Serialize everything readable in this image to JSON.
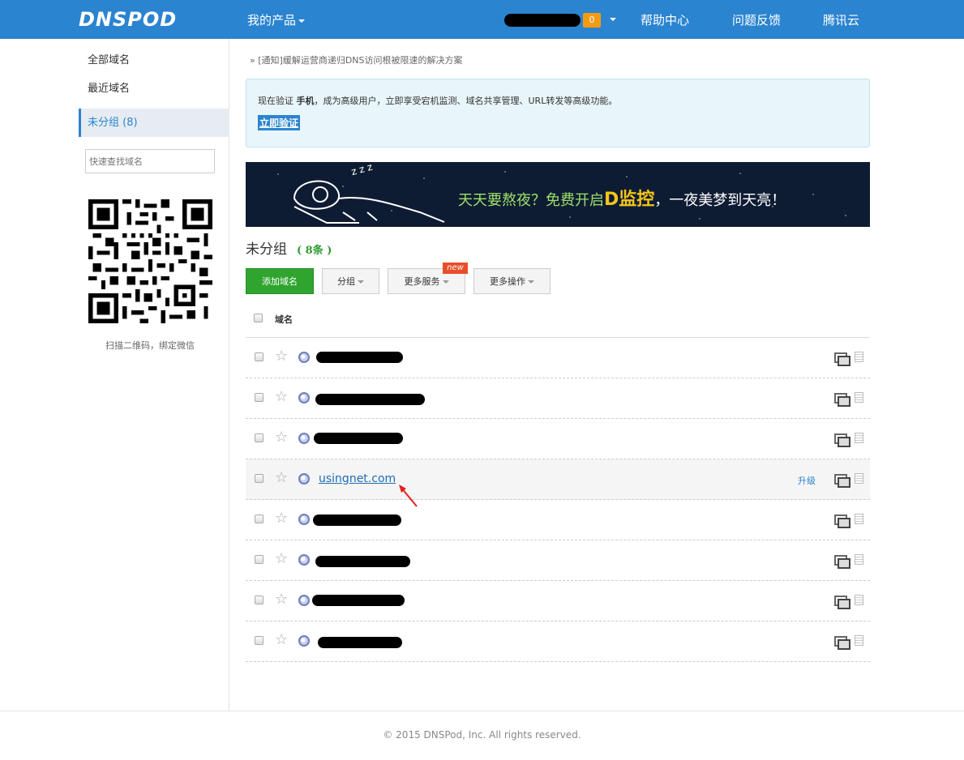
{
  "header": {
    "logo": "DNSPOD",
    "products": "我的产品",
    "messages_count": "0",
    "help": "帮助中心",
    "feedback": "问题反馈",
    "tencent": "腾讯云"
  },
  "sidebar": {
    "items": [
      {
        "label": "全部域名"
      },
      {
        "label": "最近域名"
      },
      {
        "label": "未分组 (8)"
      }
    ],
    "search_placeholder": "快速查找域名",
    "qr_caption": "扫描二维码，绑定微信"
  },
  "notice": {
    "prefix": "»",
    "text": "[通知]缓解运营商递归DNS访问根被限速的解决方案"
  },
  "verify": {
    "text_before": "现在验证",
    "bold": "手机",
    "text_after": "，成为高级用户，立即享受宕机监测、域名共享管理、URL转发等高级功能。",
    "button": "立即验证"
  },
  "banner": {
    "zzz": "z z z",
    "part1": "天天要熬夜？免费开启",
    "highlight": "D监控",
    "part2": "，一夜美梦到天亮！"
  },
  "group": {
    "title": "未分组",
    "count": "( 8条 )"
  },
  "toolbar": {
    "add_domain": "添加域名",
    "group": "分组",
    "more_services": "更多服务",
    "new_tag": "new",
    "more_actions": "更多操作"
  },
  "table": {
    "header": "域名",
    "visible_domain": "usingnet.com",
    "upgrade_label": "升级"
  },
  "footer": {
    "copyright": "© 2015 DNSPod, Inc. All rights reserved."
  },
  "colors": {
    "topbar": "#2b84cf",
    "add_button": "#2fa52f",
    "count_green": "#2e9b2e",
    "new_tag": "#e94e2a",
    "badge": "#f39c12"
  }
}
